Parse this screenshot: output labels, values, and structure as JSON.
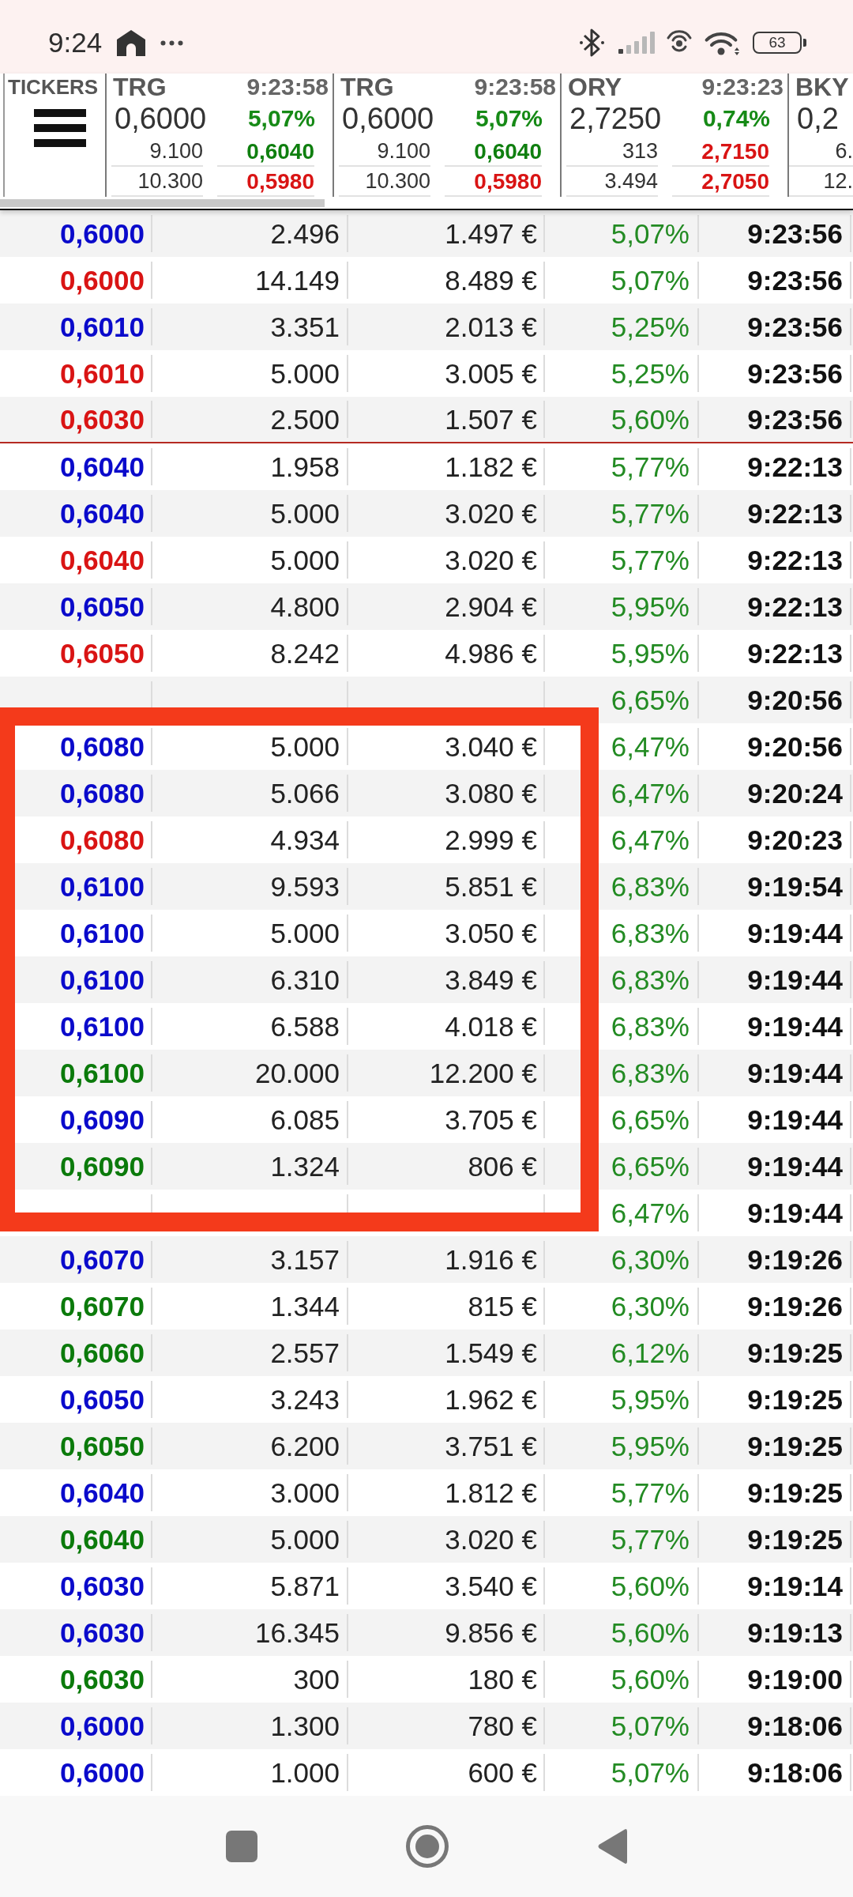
{
  "status_bar": {
    "time": "9:24",
    "battery": "63"
  },
  "tickers_panel": {
    "label": "TICKERS"
  },
  "tickers": [
    {
      "symbol": "TRG",
      "time": "9:23:58",
      "price": "0,6000",
      "change": "5,07%",
      "bid": {
        "qty": "9.100",
        "price": "0,6040",
        "color": "#0f7f0f"
      },
      "ask": {
        "qty": "10.300",
        "price": "0,5980",
        "color": "#d91414"
      }
    },
    {
      "symbol": "TRG",
      "time": "9:23:58",
      "price": "0,6000",
      "change": "5,07%",
      "bid": {
        "qty": "9.100",
        "price": "0,6040",
        "color": "#0f7f0f"
      },
      "ask": {
        "qty": "10.300",
        "price": "0,5980",
        "color": "#d91414"
      }
    },
    {
      "symbol": "ORY",
      "time": "9:23:23",
      "price": "2,7250",
      "change": "0,74%",
      "bid": {
        "qty": "313",
        "price": "2,7150",
        "color": "#d91414"
      },
      "ask": {
        "qty": "3.494",
        "price": "2,7050",
        "color": "#d91414"
      }
    },
    {
      "symbol": "BKY",
      "price": "0,2",
      "bid": {
        "qty": "6."
      },
      "ask": {
        "qty": "12."
      }
    }
  ],
  "trades": [
    {
      "price": "0,6000",
      "color": "#0a0acb",
      "qty": "2.496",
      "value": "1.497 €",
      "change": "5,07%",
      "time": "9:23:56",
      "break_after": false
    },
    {
      "price": "0,6000",
      "color": "#d91414",
      "qty": "14.149",
      "value": "8.489 €",
      "change": "5,07%",
      "time": "9:23:56",
      "break_after": false
    },
    {
      "price": "0,6010",
      "color": "#0a0acb",
      "qty": "3.351",
      "value": "2.013 €",
      "change": "5,25%",
      "time": "9:23:56",
      "break_after": false
    },
    {
      "price": "0,6010",
      "color": "#d91414",
      "qty": "5.000",
      "value": "3.005 €",
      "change": "5,25%",
      "time": "9:23:56",
      "break_after": false
    },
    {
      "price": "0,6030",
      "color": "#d91414",
      "qty": "2.500",
      "value": "1.507 €",
      "change": "5,60%",
      "time": "9:23:56",
      "break_after": true
    },
    {
      "price": "0,6040",
      "color": "#0a0acb",
      "qty": "1.958",
      "value": "1.182 €",
      "change": "5,77%",
      "time": "9:22:13",
      "break_after": false
    },
    {
      "price": "0,6040",
      "color": "#0a0acb",
      "qty": "5.000",
      "value": "3.020 €",
      "change": "5,77%",
      "time": "9:22:13",
      "break_after": false
    },
    {
      "price": "0,6040",
      "color": "#d91414",
      "qty": "5.000",
      "value": "3.020 €",
      "change": "5,77%",
      "time": "9:22:13",
      "break_after": false
    },
    {
      "price": "0,6050",
      "color": "#0a0acb",
      "qty": "4.800",
      "value": "2.904 €",
      "change": "5,95%",
      "time": "9:22:13",
      "break_after": false
    },
    {
      "price": "0,6050",
      "color": "#d91414",
      "qty": "8.242",
      "value": "4.986 €",
      "change": "5,95%",
      "time": "9:22:13",
      "break_after": false
    },
    {
      "change": "6,65%",
      "time": "9:20:56",
      "break_after": false
    },
    {
      "price": "0,6080",
      "color": "#0a0acb",
      "qty": "5.000",
      "value": "3.040 €",
      "change": "6,47%",
      "time": "9:20:56",
      "break_after": false
    },
    {
      "price": "0,6080",
      "color": "#0a0acb",
      "qty": "5.066",
      "value": "3.080 €",
      "change": "6,47%",
      "time": "9:20:24",
      "break_after": false
    },
    {
      "price": "0,6080",
      "color": "#d91414",
      "qty": "4.934",
      "value": "2.999 €",
      "change": "6,47%",
      "time": "9:20:23",
      "break_after": false
    },
    {
      "price": "0,6100",
      "color": "#0a0acb",
      "qty": "9.593",
      "value": "5.851 €",
      "change": "6,83%",
      "time": "9:19:54",
      "break_after": false
    },
    {
      "price": "0,6100",
      "color": "#0a0acb",
      "qty": "5.000",
      "value": "3.050 €",
      "change": "6,83%",
      "time": "9:19:44",
      "break_after": false
    },
    {
      "price": "0,6100",
      "color": "#0a0acb",
      "qty": "6.310",
      "value": "3.849 €",
      "change": "6,83%",
      "time": "9:19:44",
      "break_after": false
    },
    {
      "price": "0,6100",
      "color": "#0a0acb",
      "qty": "6.588",
      "value": "4.018 €",
      "change": "6,83%",
      "time": "9:19:44",
      "break_after": false
    },
    {
      "price": "0,6100",
      "color": "#0b7a0b",
      "qty": "20.000",
      "value": "12.200 €",
      "change": "6,83%",
      "time": "9:19:44",
      "break_after": false
    },
    {
      "price": "0,6090",
      "color": "#0a0acb",
      "qty": "6.085",
      "value": "3.705 €",
      "change": "6,65%",
      "time": "9:19:44",
      "break_after": false
    },
    {
      "price": "0,6090",
      "color": "#0b7a0b",
      "qty": "1.324",
      "value": "806 €",
      "change": "6,65%",
      "time": "9:19:44",
      "break_after": false
    },
    {
      "change": "6,47%",
      "time": "9:19:44",
      "break_after": false
    },
    {
      "price": "0,6070",
      "color": "#0a0acb",
      "qty": "3.157",
      "value": "1.916 €",
      "change": "6,30%",
      "time": "9:19:26",
      "break_after": false
    },
    {
      "price": "0,6070",
      "color": "#0b7a0b",
      "qty": "1.344",
      "value": "815 €",
      "change": "6,30%",
      "time": "9:19:26",
      "break_after": false
    },
    {
      "price": "0,6060",
      "color": "#0b7a0b",
      "qty": "2.557",
      "value": "1.549 €",
      "change": "6,12%",
      "time": "9:19:25",
      "break_after": false
    },
    {
      "price": "0,6050",
      "color": "#0a0acb",
      "qty": "3.243",
      "value": "1.962 €",
      "change": "5,95%",
      "time": "9:19:25",
      "break_after": false
    },
    {
      "price": "0,6050",
      "color": "#0b7a0b",
      "qty": "6.200",
      "value": "3.751 €",
      "change": "5,95%",
      "time": "9:19:25",
      "break_after": false
    },
    {
      "price": "0,6040",
      "color": "#0a0acb",
      "qty": "3.000",
      "value": "1.812 €",
      "change": "5,77%",
      "time": "9:19:25",
      "break_after": false
    },
    {
      "price": "0,6040",
      "color": "#0b7a0b",
      "qty": "5.000",
      "value": "3.020 €",
      "change": "5,77%",
      "time": "9:19:25",
      "break_after": false
    },
    {
      "price": "0,6030",
      "color": "#0a0acb",
      "qty": "5.871",
      "value": "3.540 €",
      "change": "5,60%",
      "time": "9:19:14",
      "break_after": false
    },
    {
      "price": "0,6030",
      "color": "#0a0acb",
      "qty": "16.345",
      "value": "9.856 €",
      "change": "5,60%",
      "time": "9:19:13",
      "break_after": false
    },
    {
      "price": "0,6030",
      "color": "#0b7a0b",
      "qty": "300",
      "value": "180 €",
      "change": "5,60%",
      "time": "9:19:00",
      "break_after": false
    },
    {
      "price": "0,6000",
      "color": "#0a0acb",
      "qty": "1.300",
      "value": "780 €",
      "change": "5,07%",
      "time": "9:18:06",
      "break_after": false
    },
    {
      "price": "0,6000",
      "color": "#0a0acb",
      "qty": "1.000",
      "value": "600 €",
      "change": "5,07%",
      "time": "9:18:06",
      "break_after": false
    }
  ]
}
